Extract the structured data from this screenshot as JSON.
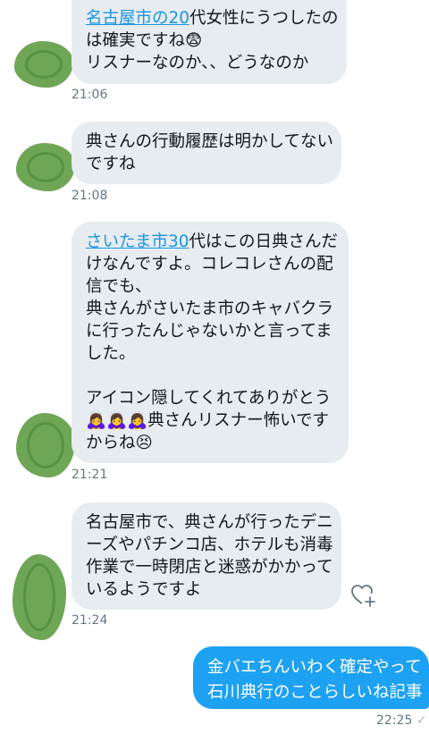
{
  "conversation": {
    "messages": [
      {
        "direction": "in",
        "lines": [
          {
            "link": "名古屋市の20",
            "text": "代女性にうつしたの"
          },
          {
            "text": "は確実ですね😨"
          },
          {
            "text": "リスナーなのか、、どうなのか"
          }
        ],
        "time": "21:06"
      },
      {
        "direction": "in",
        "lines": [
          {
            "text": "典さんの行動履歴は明かしてない"
          },
          {
            "text": "ですね"
          }
        ],
        "time": "21:08"
      },
      {
        "direction": "in",
        "lines": [
          {
            "link": "さいたま市30",
            "text": "代はこの日典さんだ"
          },
          {
            "text": "けなんですよ。コレコレさんの配"
          },
          {
            "text": "信でも、"
          },
          {
            "text": "典さんがさいたま市のキャバクラ"
          },
          {
            "text": "に行ったんじゃないかと言ってま"
          },
          {
            "text": "した。"
          },
          {
            "text": ""
          },
          {
            "text": "アイコン隠してくれてありがとう"
          },
          {
            "text": "🙇‍♀️🙇‍♀️🙇‍♀️典さんリスナー怖いです"
          },
          {
            "text": "からね😣"
          }
        ],
        "time": "21:21"
      },
      {
        "direction": "in",
        "lines": [
          {
            "text": "名古屋市で、典さんが行ったデニ"
          },
          {
            "text": "ーズやパチンコ店、ホテルも消毒"
          },
          {
            "text": "作業で一時閉店と迷惑がかかって"
          },
          {
            "text": "いるようですよ"
          }
        ],
        "time": "21:24"
      },
      {
        "direction": "out",
        "lines": [
          {
            "text": "金バエちんいわく確定やって"
          },
          {
            "text": "石川典行のことらしいね記事"
          }
        ],
        "time": "22:25",
        "status": "✓"
      }
    ],
    "icons": {
      "reaction": "heart-plus-icon",
      "avatar": "avatar-hidden-scribble"
    },
    "colors": {
      "incoming_bubble": "#e6ecf0",
      "outgoing_bubble": "#1da1f2",
      "link": "#1b95e0",
      "timestamp": "#657786",
      "avatar_scribble": "#6aa84f"
    }
  }
}
